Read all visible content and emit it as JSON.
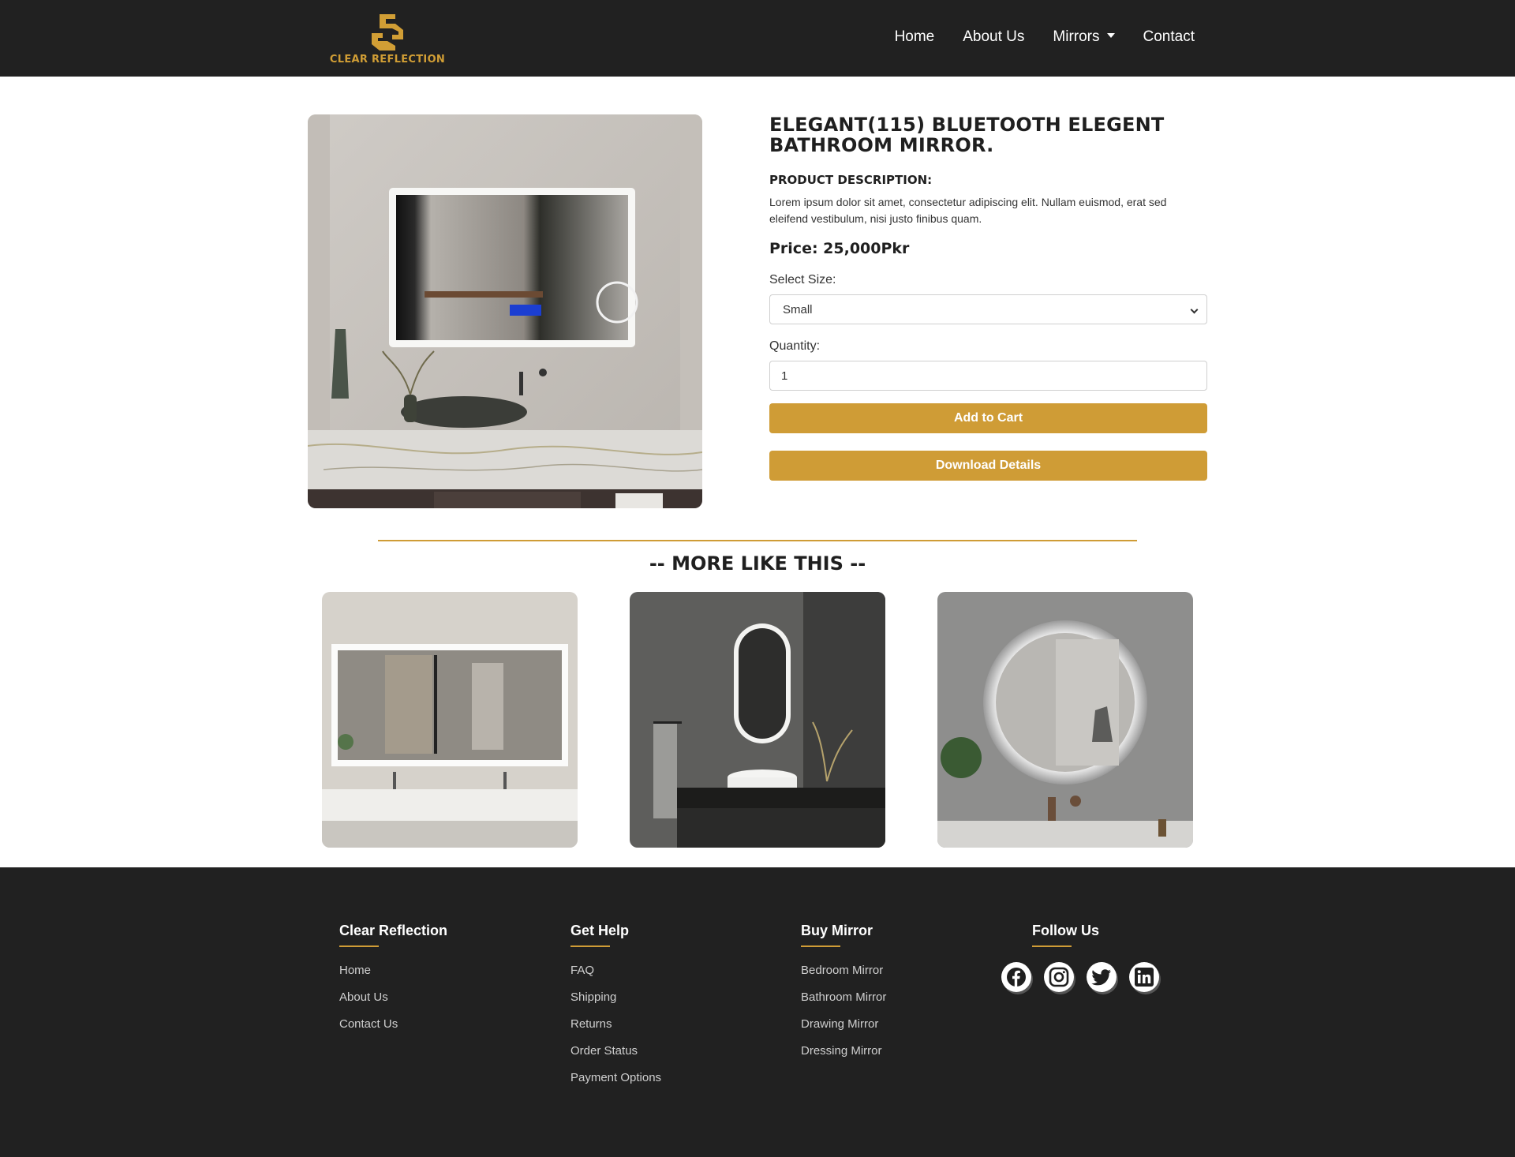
{
  "navbar": {
    "brand": "CLEAR REFLECTION",
    "links": [
      {
        "label": "Home"
      },
      {
        "label": "About Us"
      },
      {
        "label": "Mirrors"
      },
      {
        "label": "Contact"
      }
    ]
  },
  "product": {
    "title": "ELEGANT(115) BLUETOOTH ELEGENT BATHROOM MIRROR.",
    "description_heading": "PRODUCT DESCRIPTION:",
    "description": "Lorem ipsum dolor sit amet, consectetur adipiscing elit. Nullam euismod, erat sed eleifend vestibulum, nisi justo finibus quam.",
    "price": "Price: 25,000Pkr",
    "size_label": "Select Size:",
    "size_value": "Small",
    "quantity_label": "Quantity:",
    "quantity_value": "1",
    "add_to_cart": "Add to Cart",
    "download_details": "Download Details"
  },
  "more": {
    "title": "-- MORE LIKE THIS --",
    "cards": [
      {
        "icon": "rectangular-led-mirror-image"
      },
      {
        "icon": "oval-led-mirror-image"
      },
      {
        "icon": "round-led-mirror-image"
      }
    ]
  },
  "footer": {
    "col1": {
      "heading": "Clear Reflection",
      "links": [
        "Home",
        "About Us",
        "Contact Us"
      ]
    },
    "col2": {
      "heading": "Get Help",
      "links": [
        "FAQ",
        "Shipping",
        "Returns",
        "Order Status",
        "Payment Options"
      ]
    },
    "col3": {
      "heading": "Buy Mirror",
      "links": [
        "Bedroom Mirror",
        "Bathroom Mirror",
        "Drawing Mirror",
        "Dressing Mirror"
      ]
    },
    "col4": {
      "heading": "Follow Us",
      "social": [
        "facebook-icon",
        "instagram-icon",
        "twitter-icon",
        "linkedin-icon"
      ]
    }
  },
  "colors": {
    "accent": "#cf9c36",
    "dark": "#212121",
    "background": "#ffffff"
  }
}
